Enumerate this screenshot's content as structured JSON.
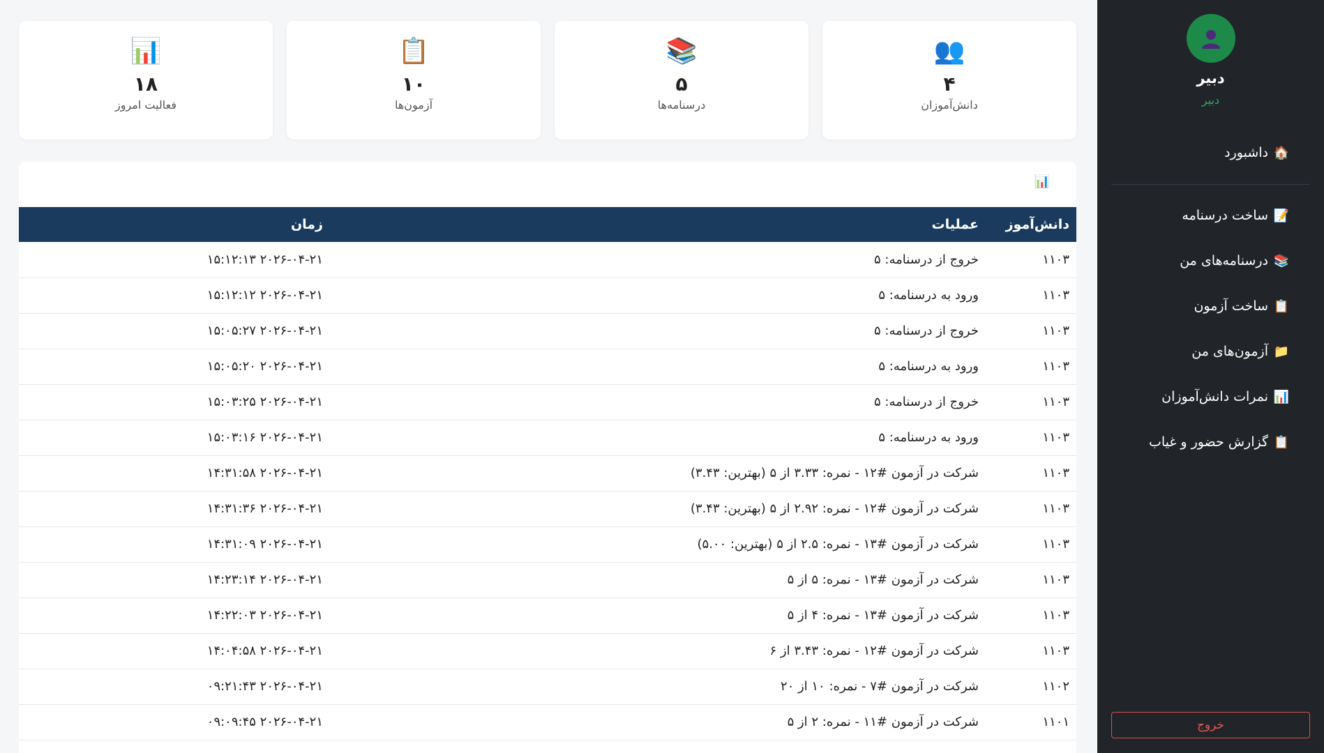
{
  "sidebar": {
    "user_name": "دبیر",
    "user_role": "دبیر",
    "nav": [
      {
        "icon": "🏠",
        "icon_name": "home-icon",
        "label": "داشبورد"
      },
      {
        "icon": "📝",
        "icon_name": "document-icon",
        "label": "ساخت درسنامه"
      },
      {
        "icon": "📚",
        "icon_name": "books-icon",
        "label": "درسنامه‌های من"
      },
      {
        "icon": "📋",
        "icon_name": "clipboard-icon",
        "label": "ساخت آزمون"
      },
      {
        "icon": "📁",
        "icon_name": "folder-icon",
        "label": "آزمون‌های من"
      },
      {
        "icon": "📊",
        "icon_name": "bar-chart-icon",
        "label": "نمرات دانش‌آموزان"
      },
      {
        "icon": "📋",
        "icon_name": "clipboard-icon",
        "label": "گزارش حضور و غیاب"
      }
    ],
    "logout_label": "خروج"
  },
  "stats": [
    {
      "icon": "👥",
      "icon_name": "users-icon",
      "value": "۴",
      "label": "دانش‌آموزان"
    },
    {
      "icon": "📚",
      "icon_name": "books-icon",
      "value": "۵",
      "label": "درسنامه‌ها"
    },
    {
      "icon": "📋",
      "icon_name": "clipboard-icon",
      "value": "۱۰",
      "label": "آزمون‌ها"
    },
    {
      "icon": "📊",
      "icon_name": "bar-chart-icon",
      "value": "۱۸",
      "label": "فعالیت امروز"
    }
  ],
  "activity": {
    "header_icon": "📊",
    "columns": {
      "student": "دانش‌آموز",
      "operation": "عملیات",
      "time": "زمان"
    },
    "rows": [
      {
        "student": "۱۱۰۳",
        "operation": "خروج از درسنامه: ۵",
        "time": "۲۰۲۶-۰۴-۲۱ ۱۵:۱۲:۱۳"
      },
      {
        "student": "۱۱۰۳",
        "operation": "ورود به درسنامه: ۵",
        "time": "۲۰۲۶-۰۴-۲۱ ۱۵:۱۲:۱۲"
      },
      {
        "student": "۱۱۰۳",
        "operation": "خروج از درسنامه: ۵",
        "time": "۲۰۲۶-۰۴-۲۱ ۱۵:۰۵:۲۷"
      },
      {
        "student": "۱۱۰۳",
        "operation": "ورود به درسنامه: ۵",
        "time": "۲۰۲۶-۰۴-۲۱ ۱۵:۰۵:۲۰"
      },
      {
        "student": "۱۱۰۳",
        "operation": "خروج از درسنامه: ۵",
        "time": "۲۰۲۶-۰۴-۲۱ ۱۵:۰۳:۲۵"
      },
      {
        "student": "۱۱۰۳",
        "operation": "ورود به درسنامه: ۵",
        "time": "۲۰۲۶-۰۴-۲۱ ۱۵:۰۳:۱۶"
      },
      {
        "student": "۱۱۰۳",
        "operation": "شرکت در آزمون #۱۲ - نمره: ۳.۳۳ از ۵ (بهترین: ۳.۴۳)",
        "time": "۲۰۲۶-۰۴-۲۱ ۱۴:۳۱:۵۸"
      },
      {
        "student": "۱۱۰۳",
        "operation": "شرکت در آزمون #۱۲ - نمره: ۲.۹۲ از ۵ (بهترین: ۳.۴۳)",
        "time": "۲۰۲۶-۰۴-۲۱ ۱۴:۳۱:۳۶"
      },
      {
        "student": "۱۱۰۳",
        "operation": "شرکت در آزمون #۱۳ - نمره: ۲.۵ از ۵ (بهترین: ۵.۰۰)",
        "time": "۲۰۲۶-۰۴-۲۱ ۱۴:۳۱:۰۹"
      },
      {
        "student": "۱۱۰۳",
        "operation": "شرکت در آزمون #۱۳ - نمره: ۵ از ۵",
        "time": "۲۰۲۶-۰۴-۲۱ ۱۴:۲۳:۱۴"
      },
      {
        "student": "۱۱۰۳",
        "operation": "شرکت در آزمون #۱۳ - نمره: ۴ از ۵",
        "time": "۲۰۲۶-۰۴-۲۱ ۱۴:۲۲:۰۳"
      },
      {
        "student": "۱۱۰۳",
        "operation": "شرکت در آزمون #۱۲ - نمره: ۳.۴۳ از ۶",
        "time": "۲۰۲۶-۰۴-۲۱ ۱۴:۰۴:۵۸"
      },
      {
        "student": "۱۱۰۲",
        "operation": "شرکت در آزمون #۷ - نمره: ۱۰ از ۲۰",
        "time": "۲۰۲۶-۰۴-۲۱ ۰۹:۲۱:۴۳"
      },
      {
        "student": "۱۱۰۱",
        "operation": "شرکت در آزمون #۱۱ - نمره: ۲ از ۵",
        "time": "۲۰۲۶-۰۴-۲۱ ۰۹:۰۹:۴۵"
      }
    ]
  }
}
